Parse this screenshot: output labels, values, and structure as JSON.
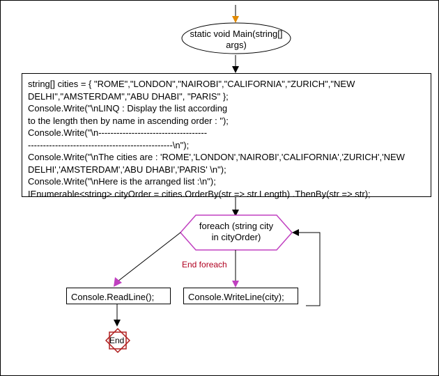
{
  "flow": {
    "start_method": "static void\nMain(string[] args)",
    "code_block": "string[] cities = { \"ROME\",\"LONDON\",\"NAIROBI\",\"CALIFORNIA\",\"ZURICH\",\"NEW DELHI\",\"AMSTERDAM\",\"ABU DHABI\", \"PARIS\" };\nConsole.Write(\"\\nLINQ : Display the list according\nto the length then by name in ascending order : \");\nConsole.Write(\"\\n------------------------------------\n------------------------------------------------\\n\");\nConsole.Write(\"\\nThe cities are : 'ROME','LONDON','NAIROBI','CALIFORNIA','ZURICH','NEW DELHI','AMSTERDAM','ABU DHABI','PARIS' \\n\");\nConsole.Write(\"\\nHere is the arranged list :\\n\");\nIEnumerable<string> cityOrder = cities.OrderBy(str => str.Length) .ThenBy(str => str);",
    "loop_header": "foreach (string\ncity in cityOrder)",
    "loop_end_label": "End foreach",
    "loop_body": "Console.WriteLine(city);",
    "after_loop": "Console.ReadLine();",
    "end": "End"
  }
}
